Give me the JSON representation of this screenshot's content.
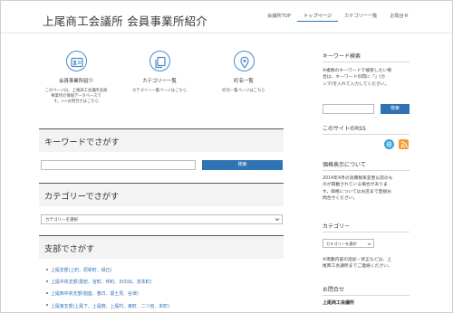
{
  "site": {
    "title": "上尾商工会議所 会員事業所紹介"
  },
  "nav": [
    {
      "label": "会議所TOP",
      "active": false
    },
    {
      "label": "トップページ",
      "active": true
    },
    {
      "label": "カテゴリー一覧",
      "active": false
    },
    {
      "label": "お問合せ",
      "active": false
    }
  ],
  "cards": [
    {
      "icon": "id-card-icon",
      "title": "会員事業所紹介",
      "desc_lines": [
        "このページは、上尾商工会議所会員",
        "事業所の情報データベースで",
        "す。>>お問合せはこちら"
      ]
    },
    {
      "icon": "copy-icon",
      "title": "カテゴリー一覧",
      "desc_lines": [
        "カテゴリー一覧ページはこちら"
      ]
    },
    {
      "icon": "map-marker-icon",
      "title": "町名一覧",
      "desc_lines": [
        "町名一覧ページはこちら"
      ]
    }
  ],
  "keyword": {
    "heading": "キーワードでさがす",
    "button": "検索"
  },
  "category": {
    "heading": "カテゴリーでさがす",
    "selected": "カテゴリーを選択"
  },
  "branch": {
    "heading": "支部でさがす",
    "items": [
      "上尾支部(上町、原新町、緑丘)",
      "上尾中央支部(愛宕、宮町、仲町、日の出、宮本町)",
      "上尾西中央支部(柏座、春日、富士見、谷津)",
      "上尾東支部(上尾下、上尾宿、上尾村、東町、二ツ宮、本町)"
    ]
  },
  "sidebar": {
    "keyword_title": "キーワード検索",
    "keyword_help": [
      "※複数のキーワードで検索したい場",
      "合は、キーワードの間に「」(カ",
      "ンマ)を入れて入力してください。"
    ],
    "search_button": "検索",
    "rss_title": "このサイトのRSS",
    "price_title": "価格表示について",
    "price_text": [
      "2014年4月の消費税率変更以前のも",
      "のが掲載されている場合がありま",
      "す。価格についてはお店まで直接お",
      "問合せください。"
    ],
    "category_title": "カテゴリー",
    "category_selected": "カテゴリーを選択",
    "notice": [
      "※掲載内容の追加・修正などは、上",
      "尾商工会議所までご連絡ください。"
    ],
    "contact_title": "お問合せ",
    "contact_org": "上尾商工会議所"
  },
  "colors": {
    "accent": "#2f73b3",
    "rss_feed": "#f39c33",
    "rss_globe": "#3aa0d8"
  }
}
